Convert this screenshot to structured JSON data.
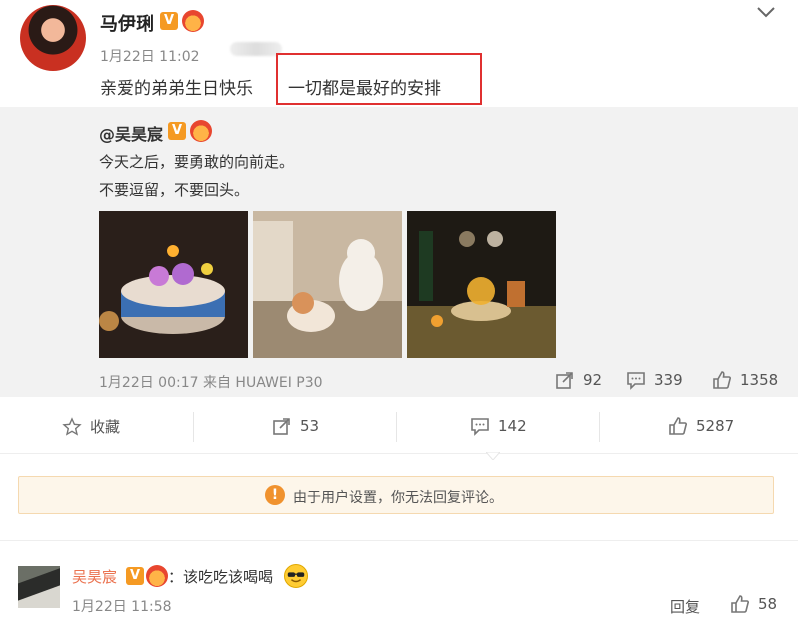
{
  "post": {
    "author": "马伊琍",
    "time": "1月22日 11:02",
    "text": "亲爱的弟弟生日快乐",
    "highlighted_text": "一切都是最好的安排"
  },
  "repost": {
    "author": "@吴昊宸",
    "lines": [
      "今天之后，要勇敢的向前走。",
      "不要逗留，不要回头。"
    ],
    "meta": "1月22日 00:17 来自 HUAWEI P30",
    "shares": "92",
    "comments": "339",
    "likes": "1358"
  },
  "actions": {
    "favorite_label": "收藏",
    "share_count": "53",
    "comment_count": "142",
    "like_count": "5287"
  },
  "notice": {
    "text": "由于用户设置，你无法回复评论。"
  },
  "comment": {
    "author": "吴昊宸",
    "text": "：该吃吃该喝喝",
    "time": "1月22日 11:58",
    "reply_label": "回复",
    "likes": "58"
  },
  "icons": {
    "verified": "v-badge-icon",
    "member": "crown-icon",
    "expand": "chevron-down-icon",
    "share": "share-icon",
    "comment": "comment-icon",
    "like": "thumbs-up-icon",
    "favorite": "star-icon",
    "warning": "exclamation-icon",
    "emoji": "cool-sunglasses-emoji"
  },
  "colors": {
    "accent": "#eb7350",
    "highlight_border": "#e03030",
    "verified": "#f59a23",
    "notice_bg": "#fdf6ea"
  }
}
